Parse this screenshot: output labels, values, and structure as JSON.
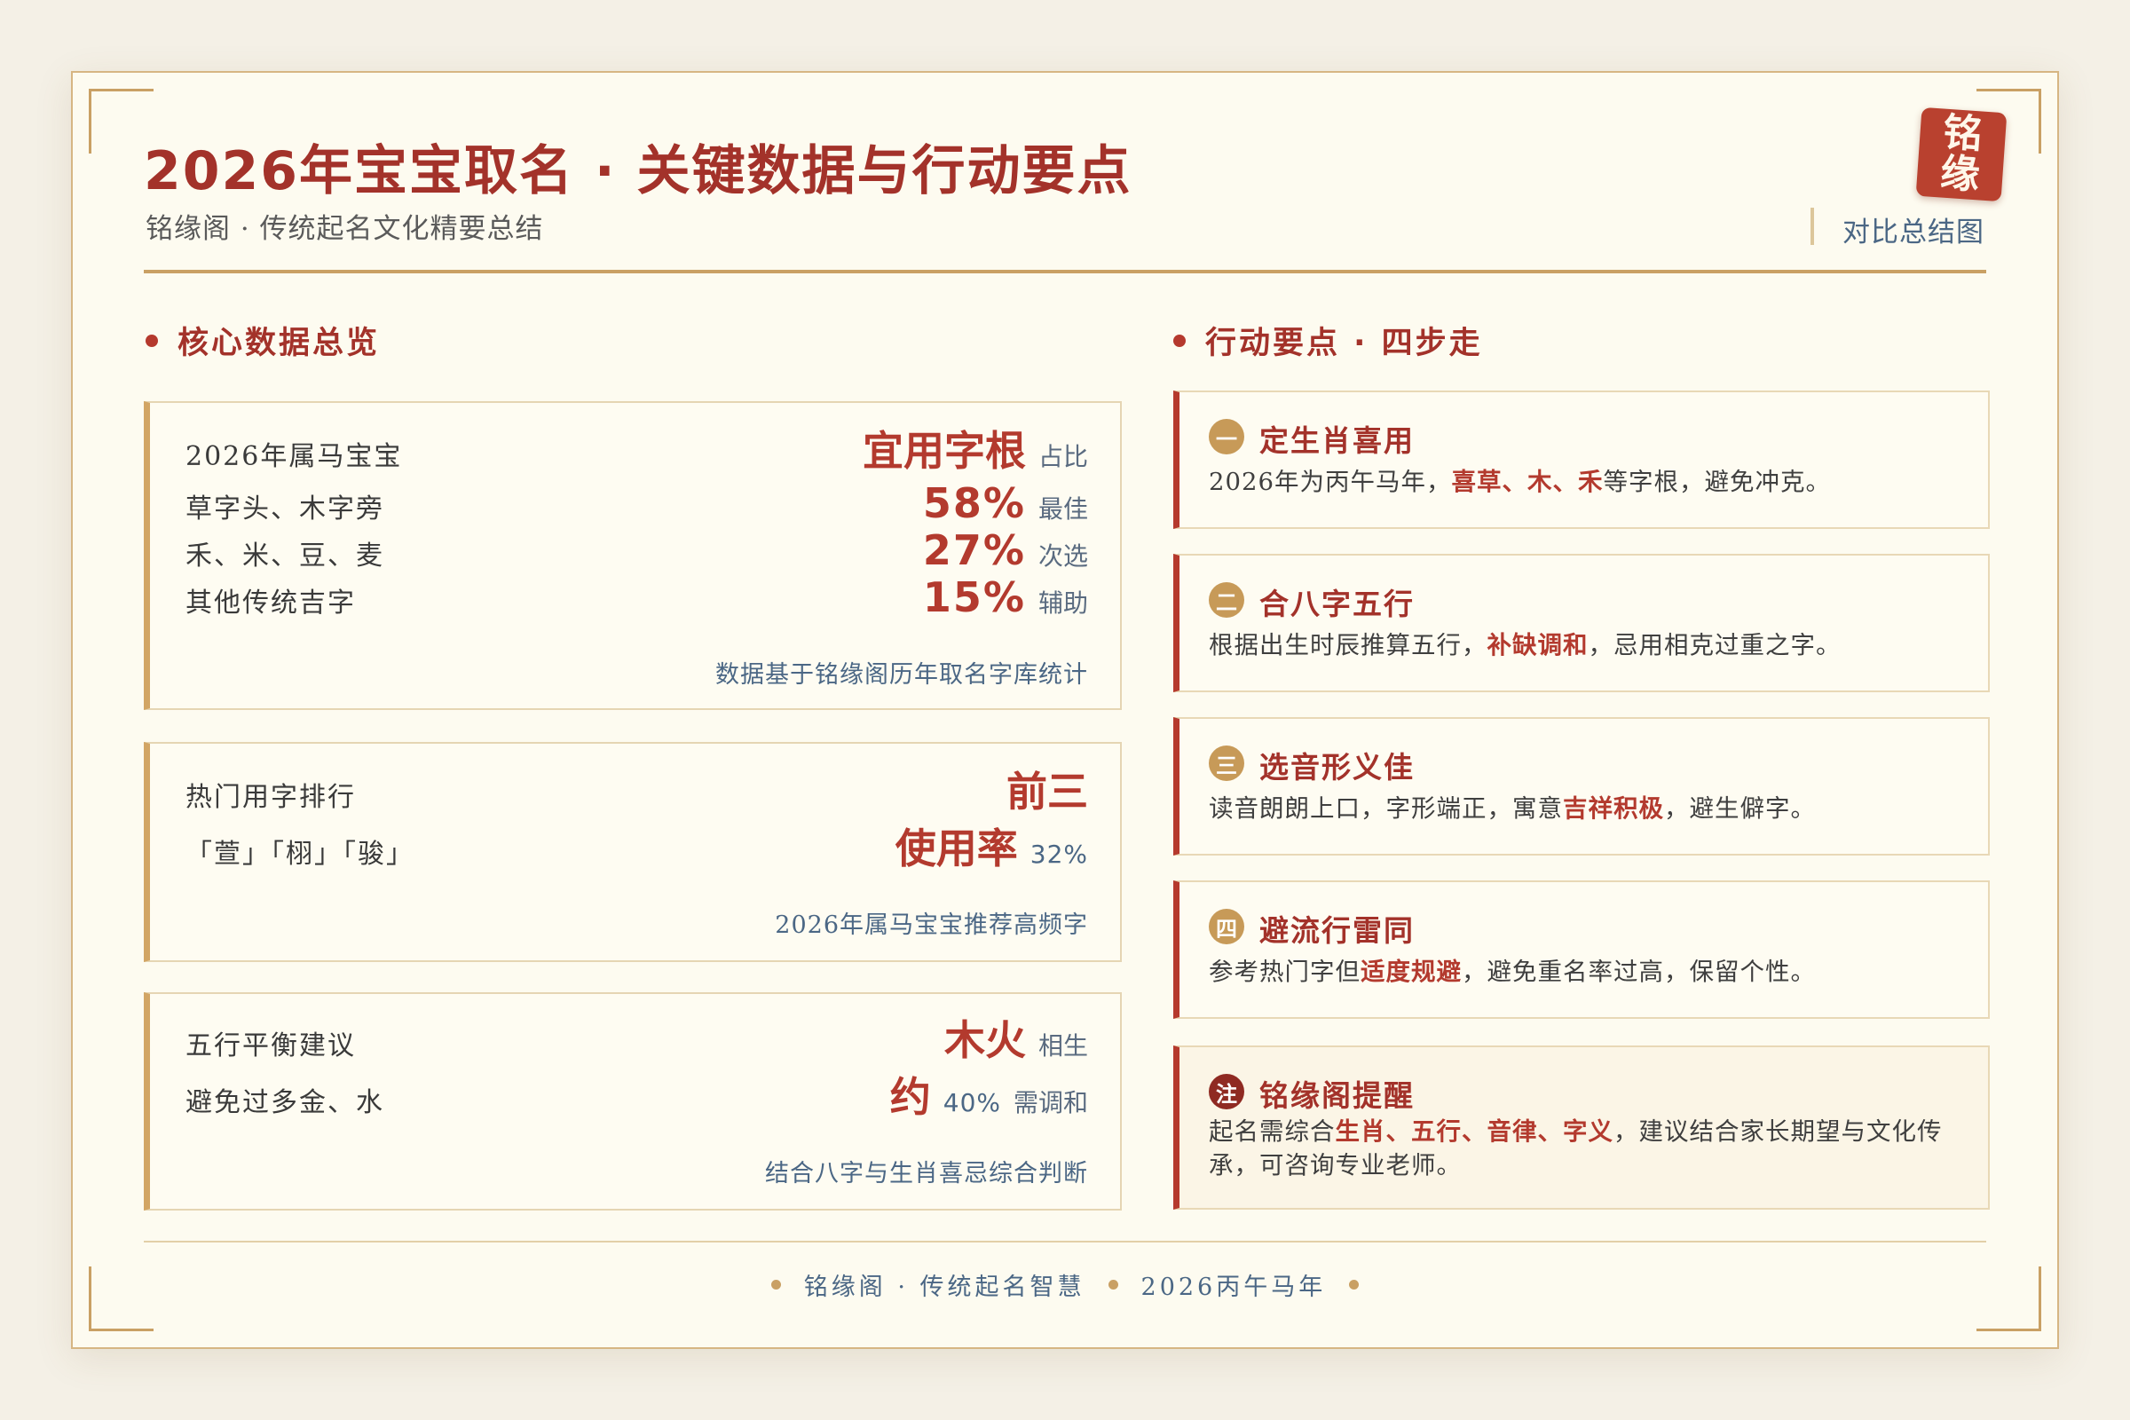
{
  "header": {
    "title": "2026年宝宝取名 · 关键数据与行动要点",
    "subtitle": "铭缘阁 · 传统起名文化精要总结",
    "compare_label": "对比总结图",
    "seal_top": "铭",
    "seal_bottom": "缘"
  },
  "left": {
    "heading": "核心数据总览",
    "card1": {
      "label": "2026年属马宝宝",
      "headline": "宜用字根",
      "headline_unit": "占比",
      "rows": [
        {
          "label": "草字头、木字旁",
          "value": "58%",
          "unit": "最佳"
        },
        {
          "label": "禾、米、豆、麦",
          "value": "27%",
          "unit": "次选"
        },
        {
          "label": "其他传统吉字",
          "value": "15%",
          "unit": "辅助"
        }
      ],
      "note": "数据基于铭缘阁历年取名字库统计"
    },
    "card2": {
      "label": "热门用字排行",
      "headline": "前三",
      "chars": "「萱」「栩」「骏」",
      "metric": "使用率",
      "metric_value": "32%",
      "note": "2026年属马宝宝推荐高频字"
    },
    "card3": {
      "label": "五行平衡建议",
      "headline": "木火",
      "headline_unit": "相生",
      "avoid": "避免过多金、水",
      "approx": "约",
      "approx_value": "40%",
      "approx_unit": "需调和",
      "note": "结合八字与生肖喜忌综合判断"
    }
  },
  "right": {
    "heading": "行动要点 · 四步走",
    "steps": [
      {
        "badge": "一",
        "title": "定生肖喜用",
        "pre": "2026年为丙午马年，",
        "hl": "喜草、木、禾",
        "post": "等字根，避免冲克。"
      },
      {
        "badge": "二",
        "title": "合八字五行",
        "pre": "根据出生时辰推算五行，",
        "hl": "补缺调和",
        "post": "，忌用相克过重之字。"
      },
      {
        "badge": "三",
        "title": "选音形义佳",
        "pre": "读音朗朗上口，字形端正，寓意",
        "hl": "吉祥积极",
        "post": "，避生僻字。"
      },
      {
        "badge": "四",
        "title": "避流行雷同",
        "pre": "参考热门字但",
        "hl": "适度规避",
        "post": "，避免重名率过高，保留个性。"
      }
    ],
    "tip": {
      "badge": "注",
      "title": "铭缘阁提醒",
      "pre": "起名需综合",
      "hl": "生肖、五行、音律、字义",
      "post": "，建议结合家长期望与文化传承，可咨询专业老师。"
    }
  },
  "footer": {
    "left": "铭缘阁 · 传统起名智慧",
    "right": "2026丙午马年"
  }
}
